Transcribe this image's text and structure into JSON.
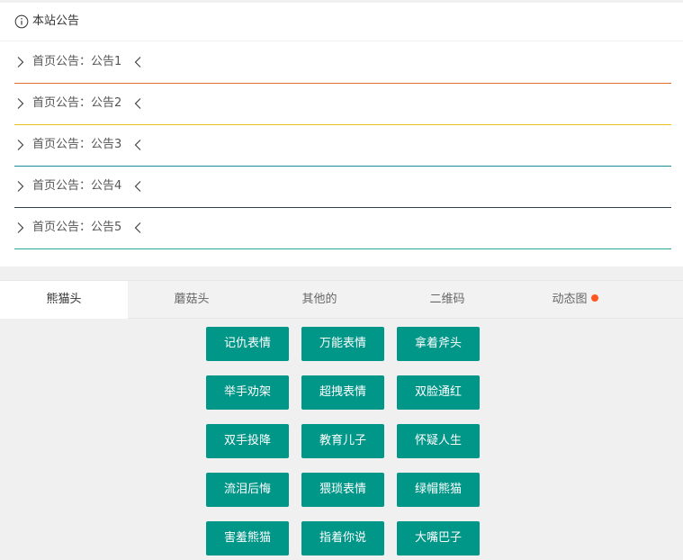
{
  "panel": {
    "title": "本站公告",
    "notices": [
      {
        "text": "首页公告：公告1",
        "line_color": "#e0702c"
      },
      {
        "text": "首页公告：公告2",
        "line_color": "#e8c21c"
      },
      {
        "text": "首页公告：公告3",
        "line_color": "#1b8c96"
      },
      {
        "text": "首页公告：公告4",
        "line_color": "#2f4050"
      },
      {
        "text": "首页公告：公告5",
        "line_color": "#2aa89b"
      }
    ]
  },
  "tabs": [
    {
      "label": "熊猫头",
      "active": true
    },
    {
      "label": "蘑菇头",
      "active": false
    },
    {
      "label": "其他的",
      "active": false
    },
    {
      "label": "二维码",
      "active": false
    },
    {
      "label": "动态图",
      "active": false,
      "dot": true
    }
  ],
  "buttons": [
    [
      "记仇表情",
      "万能表情",
      "拿着斧头"
    ],
    [
      "举手劝架",
      "超拽表情",
      "双脸通红"
    ],
    [
      "双手投降",
      "教育儿子",
      "怀疑人生"
    ],
    [
      "流泪后悔",
      "猥琐表情",
      "绿帽熊猫"
    ],
    [
      "害羞熊猫",
      "指着你说",
      "大嘴巴子"
    ]
  ],
  "colors": {
    "button": "#009688",
    "tab_dot": "#ff5722"
  },
  "icons": {
    "header": "info-circle-icon",
    "notice_left": "chevron-right-icon",
    "notice_right": "chevron-left-icon"
  }
}
